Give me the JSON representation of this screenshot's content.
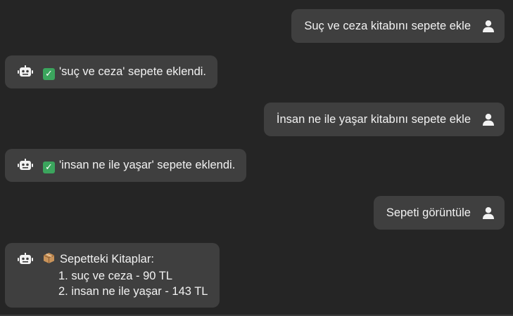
{
  "messages": [
    {
      "role": "user",
      "text": "Suç ve ceza kitabını sepete ekle",
      "icon": "user-icon"
    },
    {
      "role": "bot",
      "text": "'suç ve ceza' sepete eklendi.",
      "status_icon": "check-mark-icon",
      "icon": "robot-icon"
    },
    {
      "role": "user",
      "text": "İnsan ne ile yaşar kitabını sepete ekle",
      "icon": "user-icon"
    },
    {
      "role": "bot",
      "text": "'insan ne ile yaşar' sepete eklendi.",
      "status_icon": "check-mark-icon",
      "icon": "robot-icon"
    },
    {
      "role": "user",
      "text": "Sepeti görüntüle",
      "icon": "user-icon"
    },
    {
      "role": "bot",
      "title": "Sepetteki Kitaplar:",
      "title_icon": "package-icon",
      "icon": "robot-icon",
      "items": [
        "1. suç ve ceza - 90 TL",
        "2. insan ne ile yaşar - 143 TL"
      ]
    }
  ],
  "colors": {
    "background": "#252525",
    "bubble": "#3f3f3f",
    "text": "#f2f2f2",
    "check": "#3ba55d",
    "package": "#c8935a"
  }
}
